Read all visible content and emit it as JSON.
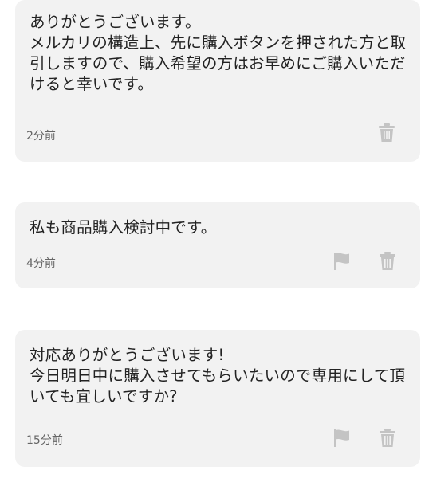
{
  "comments": [
    {
      "text": "ありがとうございます。\nメルカリの構造上、先に購入ボタンを押された方と取引しますので、購入希望の方はお早めにご購入いただけると幸いです。",
      "time": "2分前",
      "icons": [
        "trash-icon"
      ]
    },
    {
      "text": "私も商品購入検討中です。",
      "time": "4分前",
      "icons": [
        "flag-icon",
        "trash-icon"
      ]
    },
    {
      "text": "対応ありがとうございます!\n今日明日中に購入させてもらいたいので専用にして頂いても宜しいですか?",
      "time": "15分前",
      "icons": [
        "flag-icon",
        "trash-icon"
      ]
    }
  ],
  "colors": {
    "card_background": "#f2f2f2",
    "text": "#222222",
    "timestamp": "#666666",
    "icon": "#c4c4c4"
  }
}
